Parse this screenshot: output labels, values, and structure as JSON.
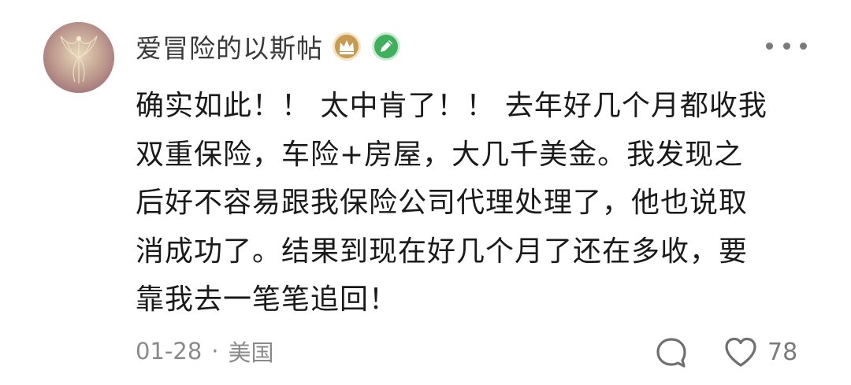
{
  "comment": {
    "author": {
      "name": "爱冒险的以斯帖",
      "badges": [
        "crown-badge-icon",
        "pencil-badge-icon"
      ]
    },
    "text_lines": [
      "确实如此！！ 太中肯了！！ 去年好几个月都收我",
      "双重保险，车险+房屋，大几千美金。我发现之",
      "后好不容易跟我保险公司代理处理了，他也说取",
      "消成功了。结果到现在好几个月了还在多收，要",
      "靠我去一笔笔追回！"
    ],
    "date": "01-28",
    "separator": "·",
    "location": "美国",
    "likes": "78"
  },
  "icons": {
    "more": "more-dots-icon",
    "reply": "comment-bubble-icon",
    "like": "heart-icon"
  },
  "colors": {
    "crown_badge": "#c89a52",
    "pencil_badge": "#3fae5d",
    "muted_text": "#8a8a8a"
  }
}
